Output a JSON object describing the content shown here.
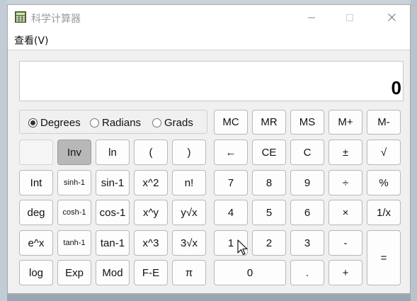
{
  "window": {
    "title": "科学计算器",
    "minimize_icon": "minimize-icon",
    "maximize_icon": "maximize-icon",
    "close_icon": "close-icon"
  },
  "menu": {
    "view_label": "查看(V)"
  },
  "display": {
    "value": "0"
  },
  "angle_mode": {
    "options": [
      "Degrees",
      "Radians",
      "Grads"
    ],
    "selected": "Degrees"
  },
  "memory_buttons": [
    "MC",
    "MR",
    "MS",
    "M+",
    "M-"
  ],
  "sci_buttons": {
    "row1": [
      "",
      "Inv",
      "ln",
      "(",
      ")"
    ],
    "row2": [
      "Int",
      "sinh-1",
      "sin-1",
      "x^2",
      "n!"
    ],
    "row3": [
      "deg",
      "cosh-1",
      "cos-1",
      "x^y",
      "y√x"
    ],
    "row4": [
      "e^x",
      "tanh-1",
      "tan-1",
      "x^3",
      "3√x"
    ],
    "row5": [
      "log",
      "Exp",
      "Mod",
      "F-E",
      "π"
    ]
  },
  "std_buttons": {
    "row1": [
      "←",
      "CE",
      "C",
      "±",
      "√"
    ],
    "row2": [
      "7",
      "8",
      "9",
      "÷",
      "%"
    ],
    "row3": [
      "4",
      "5",
      "6",
      "×",
      "1/x"
    ],
    "row4": [
      "1",
      "2",
      "3",
      "-",
      "="
    ],
    "row5": [
      "0",
      ".",
      "+"
    ]
  }
}
